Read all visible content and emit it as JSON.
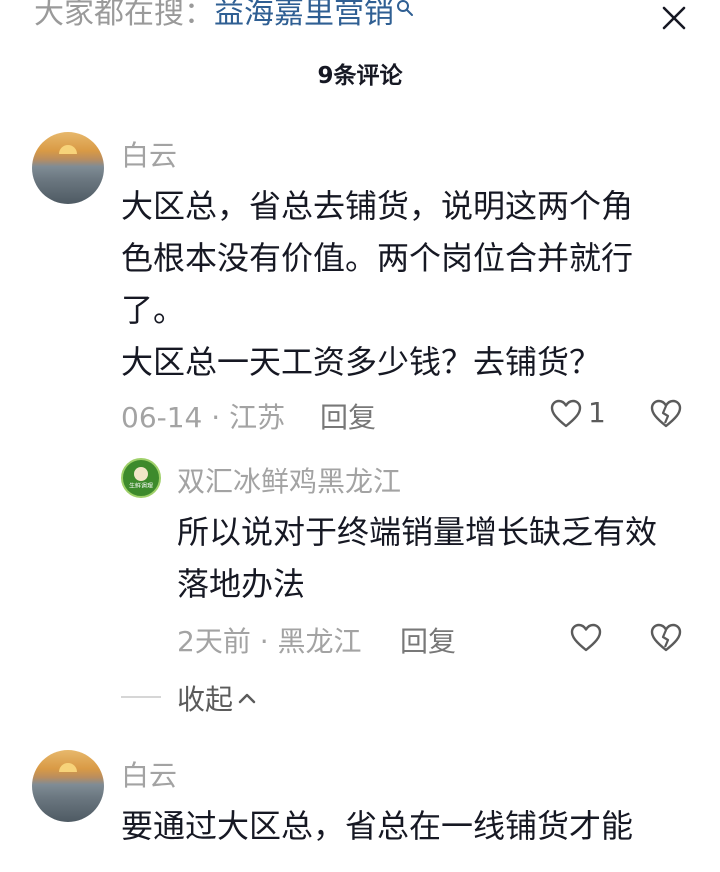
{
  "search": {
    "prefix": "大家都在搜：",
    "keyword": "益海嘉里营销"
  },
  "header": {
    "title": "9条评论"
  },
  "comments": [
    {
      "user": "白云",
      "text_lines": [
        "大区总，省总去铺货，说明这两个角",
        "色根本没有价值。两个岗位合并就行",
        "了。",
        "大区总一天工资多少钱？去铺货？"
      ],
      "date": "06-14",
      "location": "江苏",
      "reply_label": "回复",
      "like_count": "1"
    },
    {
      "user": "白云",
      "text_lines": [
        "要通过大区总，省总在一线铺货才能"
      ]
    }
  ],
  "reply": {
    "user": "双汇冰鲜鸡黑龙江",
    "avatar_text": "生鲜调理",
    "text_lines": [
      "所以说对于终端销量增长缺乏有效",
      "落地办法"
    ],
    "date": "2天前",
    "location": "黑龙江",
    "reply_label": "回复"
  },
  "collapse_label": "收起",
  "separator": "·",
  "colors": {
    "keyword": "#2f5f93",
    "meta": "#a3a3a3",
    "text": "#161823",
    "brand_green": "#3d8a2c"
  },
  "icons": [
    "search-icon",
    "close-icon",
    "heart-icon",
    "dislike-icon",
    "chevron-up-icon"
  ]
}
